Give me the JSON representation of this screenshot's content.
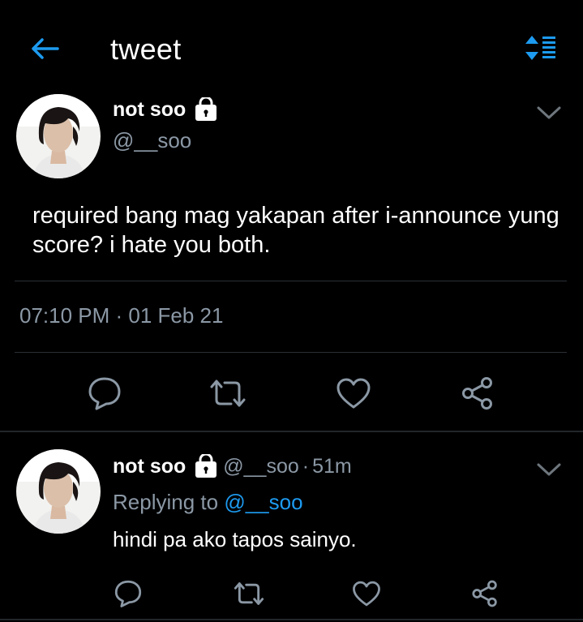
{
  "header": {
    "title": "tweet",
    "back_icon": "arrow-left-icon",
    "sort_icon": "sort-icon",
    "accent": "#1d9bf0"
  },
  "tweet": {
    "name": "not soo",
    "handle": "@__soo",
    "locked": true,
    "text": "required bang mag yakapan after i-announce yung score? i hate you both.",
    "timestamp": "07:10 PM · 01 Feb 21"
  },
  "reply": {
    "name": "not soo",
    "handle": "@__soo",
    "separator": "·",
    "time": "51m",
    "replying_prefix": "Replying to",
    "replying_to": "@__soo",
    "text": "hindi pa ako tapos sainyo."
  },
  "colors": {
    "background": "#000000",
    "secondary_text": "#8b98a5",
    "icon": "#8b98a5",
    "link": "#1d9bf0"
  }
}
